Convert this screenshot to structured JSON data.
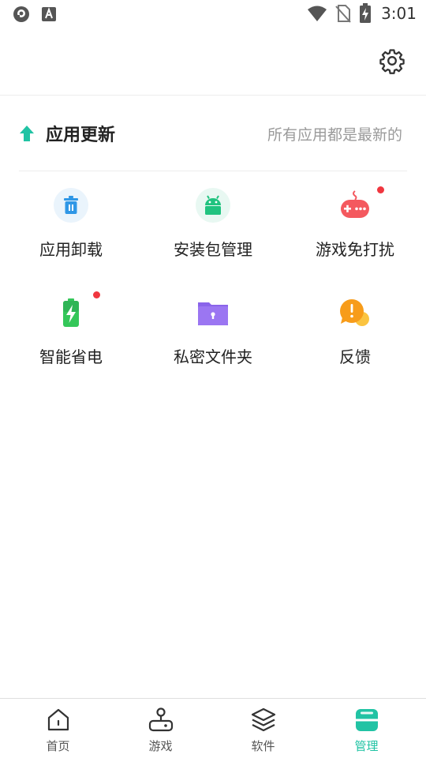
{
  "status_bar": {
    "time": "3:01"
  },
  "colors": {
    "accent": "#21c3a4",
    "badge": "#f0363f",
    "muted": "#9a9a9a"
  },
  "header": {
    "settings_icon": "gear-icon"
  },
  "update": {
    "title": "应用更新",
    "status": "所有应用都是最新的",
    "icon": "arrow-up-icon"
  },
  "tools": [
    {
      "label": "应用卸载",
      "icon": "trash-icon",
      "badge": false
    },
    {
      "label": "安装包管理",
      "icon": "android-icon",
      "badge": false
    },
    {
      "label": "游戏免打扰",
      "icon": "gamepad-icon",
      "badge": true
    },
    {
      "label": "智能省电",
      "icon": "battery-icon",
      "badge": true
    },
    {
      "label": "私密文件夹",
      "icon": "lock-folder-icon",
      "badge": false
    },
    {
      "label": "反馈",
      "icon": "feedback-icon",
      "badge": false
    }
  ],
  "bottom_nav": [
    {
      "label": "首页",
      "icon": "home-icon",
      "active": false
    },
    {
      "label": "游戏",
      "icon": "joystick-icon",
      "active": false
    },
    {
      "label": "软件",
      "icon": "layers-icon",
      "active": false
    },
    {
      "label": "管理",
      "icon": "manage-icon",
      "active": true
    }
  ]
}
